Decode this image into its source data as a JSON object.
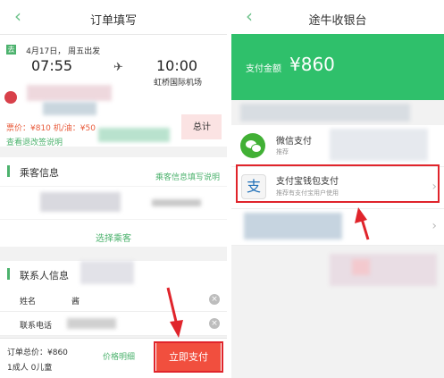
{
  "left": {
    "header": {
      "back_icon": "chevron-left-icon",
      "title": "订单填写"
    },
    "flight": {
      "date": "4月17日， 周五出发",
      "dep_time": "07:55",
      "arr_time": "10:00",
      "arr_airport": "虹桥国际机场",
      "plane_icon": "airplane-icon",
      "price_line": "票价：¥810  机/油：¥50",
      "total_label": "总计",
      "refund_link": "查看退改签说明"
    },
    "passenger": {
      "section_title": "乘客信息",
      "instructions_link": "乘客信息填写说明",
      "select_link": "选择乘客"
    },
    "contact": {
      "section_title": "联系人信息",
      "name_label": "姓名",
      "name_value": "酱",
      "phone_label": "联系电话"
    },
    "footer": {
      "total_label": "订单总价：¥860",
      "detail_link": "价格明细",
      "count": "1成人   0儿童",
      "pay_button": "立即支付"
    }
  },
  "right": {
    "header": {
      "back_icon": "chevron-left-icon",
      "title": "途牛收银台"
    },
    "amount": {
      "label": "支付金额",
      "value": "¥860"
    },
    "methods": [
      {
        "icon": "wechat-icon",
        "name": "微信支付",
        "desc": "推荐"
      },
      {
        "icon": "alipay-icon",
        "name": "支付宝钱包支付",
        "desc": "推荐有支付宝用户使用"
      }
    ]
  },
  "colors": {
    "brand_green": "#2fc06b",
    "pay_red": "#f14f3e",
    "highlight_red": "#e0242b"
  }
}
